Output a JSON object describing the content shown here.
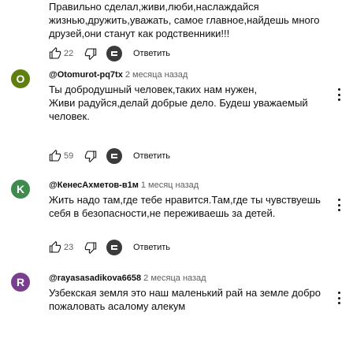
{
  "top_comment": {
    "text": "Правильно сделал,живи,люби,наслаждайся жизнью,дружить,уважать, самое главное,найдешь много друзей,они  станут как родственники!!!",
    "likes": "22",
    "reply_label": "Ответить"
  },
  "comments": [
    {
      "avatar_letter": "O",
      "avatar_color": "#5f7f0e",
      "author": "@Otomurot-pq7tx",
      "time": "2 месяца назад",
      "text": "Ты добродушный человек,таких нам нужен,\nЖиви радуйся,делай добрые дело. Будеш уважаемый человек.",
      "likes": "59",
      "reply_label": "Ответить"
    },
    {
      "avatar_letter": "K",
      "avatar_color": "#3f8a4d",
      "author": "@КенесАхметов-в1м",
      "time": "1 месяц назад",
      "text": "Жить надо там,где тебе нравится.Там,где ты чувствуешь себя в безопасности,не переживаешь за детей.",
      "likes": "23",
      "reply_label": "Ответить"
    },
    {
      "avatar_letter": "R",
      "avatar_color": "#7a3e8e",
      "author": "@rayasasadikova6658",
      "time": "2 месяца назад",
      "text": "Узбекская земля это наш маленький рай на земле добро пожаловать асаломy алекум"
    }
  ],
  "colors": {
    "muted": "#606060",
    "text": "#0f0f0f"
  },
  "icons": {
    "like": "thumb-up-icon",
    "dislike": "thumb-down-icon",
    "creator_heart": "creator-avatar-icon",
    "menu": "more-vert-icon"
  }
}
